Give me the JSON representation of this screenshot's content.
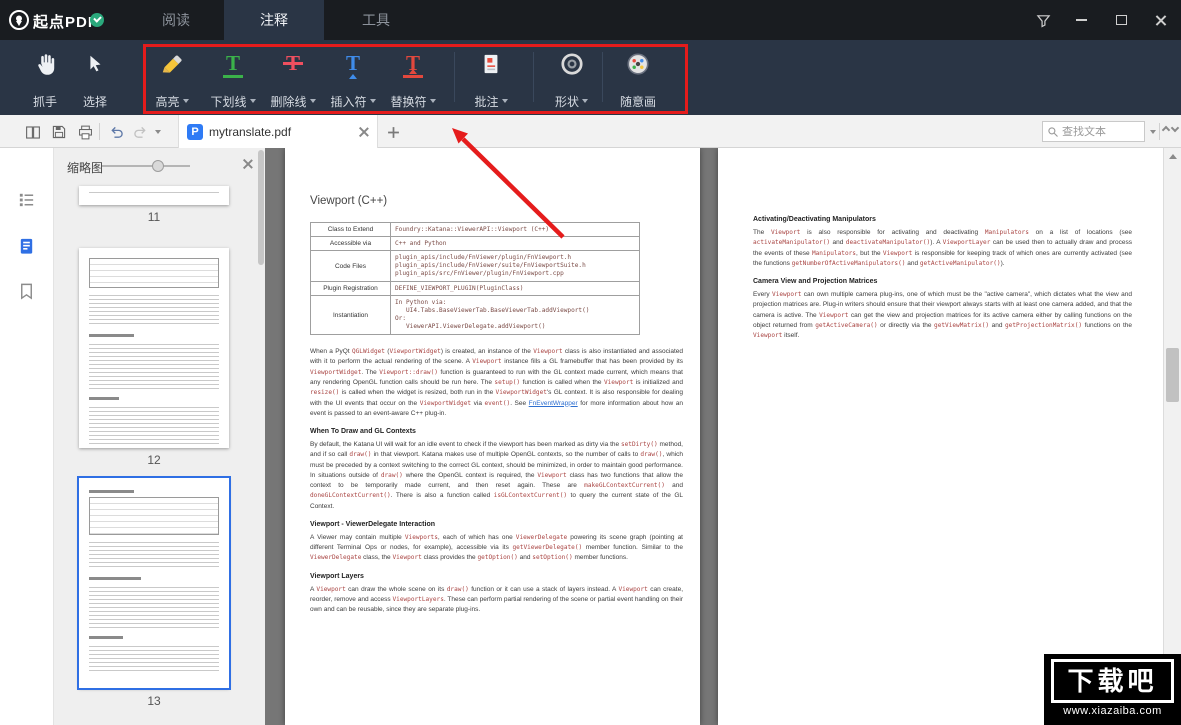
{
  "icons": {
    "text_tool_letter": "T"
  },
  "titlebar": {
    "app_name": "起点PDF",
    "tabs": [
      {
        "label": "阅读"
      },
      {
        "label": "注释"
      },
      {
        "label": "工具"
      }
    ]
  },
  "ribbon": {
    "tools": [
      {
        "label": "抓手"
      },
      {
        "label": "选择"
      },
      {
        "label": "高亮"
      },
      {
        "label": "下划线"
      },
      {
        "label": "删除线"
      },
      {
        "label": "插入符"
      },
      {
        "label": "替换符"
      },
      {
        "label": "批注"
      },
      {
        "label": "形状"
      },
      {
        "label": "随意画"
      }
    ]
  },
  "quickbar": {
    "document_tab": {
      "label": "mytranslate.pdf",
      "icon_letter": "P"
    },
    "search": {
      "placeholder": "查找文本"
    }
  },
  "sidebar": {
    "panel_title": "缩略图",
    "thumbnails": [
      {
        "page": "11"
      },
      {
        "page": "12"
      },
      {
        "page": "13"
      }
    ]
  },
  "document": {
    "page_left": {
      "title": "Viewport (C++)",
      "table": {
        "rows": [
          {
            "label": "Class to Extend",
            "value": "Foundry::Katana::ViewerAPI::Viewport (C++)"
          },
          {
            "label": "Accessible via",
            "value": "C++ and Python"
          },
          {
            "label": "Code Files",
            "value": "plugin_apis/include/FnViewer/plugin/FnViewport.h\nplugin_apis/include/FnViewer/suite/FnViewportSuite.h\nplugin_apis/src/FnViewer/plugin/FnViewport.cpp"
          },
          {
            "label": "Plugin Registration",
            "value": "DEFINE_VIEWPORT_PLUGIN(PluginClass)"
          },
          {
            "label": "Instantiation",
            "value": "In Python via:\n   UI4.Tabs.BaseViewerTab.BaseViewerTab.addViewport()\nOr:\n   ViewerAPI.ViewerDelegate.addViewport()"
          }
        ]
      },
      "paragraph_intro": "When a PyQt `QGLWidget` (`ViewportWidget`) is created, an instance of the `Viewport` class is also instantiated and associated with it to perform the actual rendering of the scene. A `Viewport` instance fills a GL framebuffer that has been provided by its `ViewportWidget`. The `Viewport::draw()` function is guaranteed to run with the GL context made current, which means that any rendering OpenGL function calls should be run here. The `setup()` function is called when the `Viewport` is initialized and `resize()` is called when the widget is resized, both run in the `ViewportWidget`'s GL context. It is also responsible for dealing with the UI events that occur on the `ViewportWidget` via `event()`. See ~FnEventWrapper~ for more information about how an event is passed to an event-aware C++ plug-in.",
      "sections": [
        {
          "heading": "When To Draw and GL Contexts",
          "body": "By default, the Katana UI will wait for an idle event to check if the viewport has been marked as dirty via the `setDirty()` method, and if so call `draw()` in that viewport. Katana makes use of multiple OpenGL contexts, so the number of calls to `draw()`, which must be preceded by a context switching to the correct GL context, should be minimized, in order to maintain good performance. In situations outside of `draw()` where the OpenGL context is required, the `Viewport` class has two functions that allow the context to be temporarily made current, and then reset again. These are `makeGLContextCurrent()` and `doneGLContextCurrent()`. There is also a function called `isGLContextCurrent()` to query the current state of the GL Context."
        },
        {
          "heading": "Viewport - ViewerDelegate Interaction",
          "body": "A Viewer may contain multiple `Viewports`, each of which has one `ViewerDelegate` powering its scene graph (pointing at different Terminal Ops or nodes, for example), accessible via its `getViewerDelegate()` member function. Similar to the `ViewerDelegate` class, the `Viewport` class provides the `getOption()` and `setOption()` member functions."
        },
        {
          "heading": "Viewport Layers",
          "body": "A `Viewport` can draw the whole scene on its `draw()` function or it can use a stack of layers instead. A `Viewport` can create, reorder, remove and access `ViewportLayers`. These can perform partial rendering of the scene or partial event handling on their own and can be reusable, since they are separate plug-ins."
        }
      ]
    },
    "page_right": {
      "sections": [
        {
          "heading": "Activating/Deactivating Manipulators",
          "body": "The `Viewport` is also responsible for activating and deactivating `Manipulators` on a list of locations (see `activateManipulator()` and `deactivateManipulator()`). A `ViewportLayer` can be used then to actually draw and process the events of these `Manipulators`, but the `Viewport` is responsible for keeping track of which ones are currently activated (see the functions `getNumberOfActiveManipulators()` and `getActiveManipulator()`)."
        },
        {
          "heading": "Camera View and Projection Matrices",
          "body": "Every `Viewport` can own multiple camera plug-ins, one of which must be the \"active camera\", which dictates what the view and projection matrices are. Plug-in writers should ensure that their viewport always starts with at least one camera added, and that the camera is active. The `Viewport` can get the view and projection matrices for its active camera either by calling functions on the object returned from `getActiveCamera()` or directly via the `getViewMatrix()` and `getProjectionMatrix()` functions on the `Viewport` itself."
        }
      ]
    }
  },
  "watermark": {
    "logo_text": "下载吧",
    "url": "www.xiazaiba.com"
  }
}
